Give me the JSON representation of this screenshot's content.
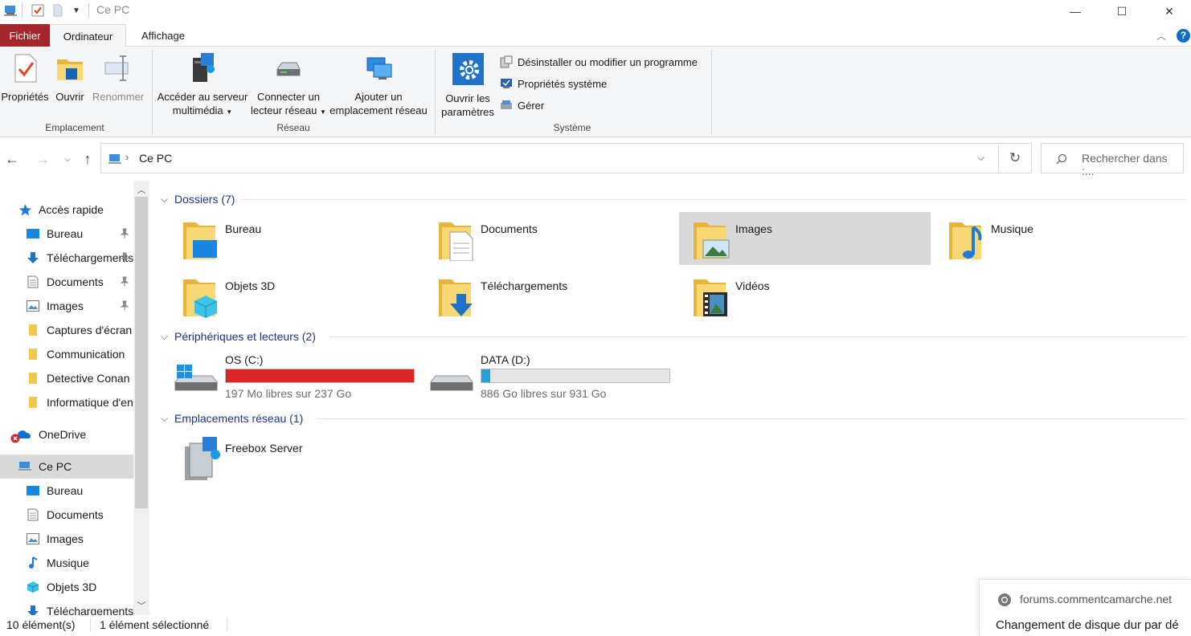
{
  "window": {
    "title": "Ce PC",
    "controls": {
      "minimize": "—",
      "maximize": "☐",
      "close": "✕"
    }
  },
  "ribbon": {
    "tabs": {
      "file": "Fichier",
      "computer": "Ordinateur",
      "view": "Affichage"
    },
    "emplacement": {
      "label": "Emplacement",
      "properties": "Propriétés",
      "open": "Ouvrir",
      "rename": "Renommer"
    },
    "reseau": {
      "label": "Réseau",
      "media_server_1": "Accéder au serveur",
      "media_server_2": "multimédia",
      "map_drive_1": "Connecter un",
      "map_drive_2": "lecteur réseau",
      "add_location_1": "Ajouter un",
      "add_location_2": "emplacement réseau"
    },
    "systeme": {
      "label": "Système",
      "open_settings_1": "Ouvrir les",
      "open_settings_2": "paramètres",
      "uninstall": "Désinstaller ou modifier un programme",
      "system_properties": "Propriétés système",
      "manage": "Gérer"
    }
  },
  "navbar": {
    "breadcrumb": "Ce PC",
    "search_placeholder": "Rechercher dans :..."
  },
  "navpane": {
    "quick_access": "Accès rapide",
    "quick_items": [
      {
        "label": "Bureau"
      },
      {
        "label": "Téléchargements"
      },
      {
        "label": "Documents"
      },
      {
        "label": "Images"
      },
      {
        "label": "Captures d'écran"
      },
      {
        "label": "Communication"
      },
      {
        "label": "Detective Conan"
      },
      {
        "label": "Informatique d'entreprise"
      }
    ],
    "onedrive": "OneDrive",
    "this_pc": "Ce PC",
    "pc_items": [
      {
        "label": "Bureau"
      },
      {
        "label": "Documents"
      },
      {
        "label": "Images"
      },
      {
        "label": "Musique"
      },
      {
        "label": "Objets 3D"
      },
      {
        "label": "Téléchargements"
      }
    ]
  },
  "content": {
    "folders_header": "Dossiers (7)",
    "folders": [
      {
        "label": "Bureau"
      },
      {
        "label": "Documents"
      },
      {
        "label": "Images"
      },
      {
        "label": "Musique"
      },
      {
        "label": "Objets 3D"
      },
      {
        "label": "Téléchargements"
      },
      {
        "label": "Vidéos"
      }
    ],
    "drives_header": "Périphériques et lecteurs (2)",
    "drives": [
      {
        "name": "OS (C:)",
        "free": "197 Mo libres sur 237 Go",
        "used_fraction": 0.999,
        "bar_color": "#da2626"
      },
      {
        "name": "DATA (D:)",
        "free": "886 Go libres sur 931 Go",
        "used_fraction": 0.048,
        "bar_color": "#26a0da"
      }
    ],
    "network_header": "Emplacements réseau (1)",
    "network": [
      {
        "label": "Freebox Server"
      }
    ]
  },
  "status": {
    "count": "10 élément(s)",
    "selection": "1 élément sélectionné"
  },
  "toast": {
    "site": "forums.commentcamarche.net",
    "message": "Changement de disque dur par dé"
  },
  "colors": {
    "file_tab": "#a4262c",
    "section_text": "#1e3287",
    "selection": "#d9d9d9",
    "accent": "#0078d7"
  }
}
